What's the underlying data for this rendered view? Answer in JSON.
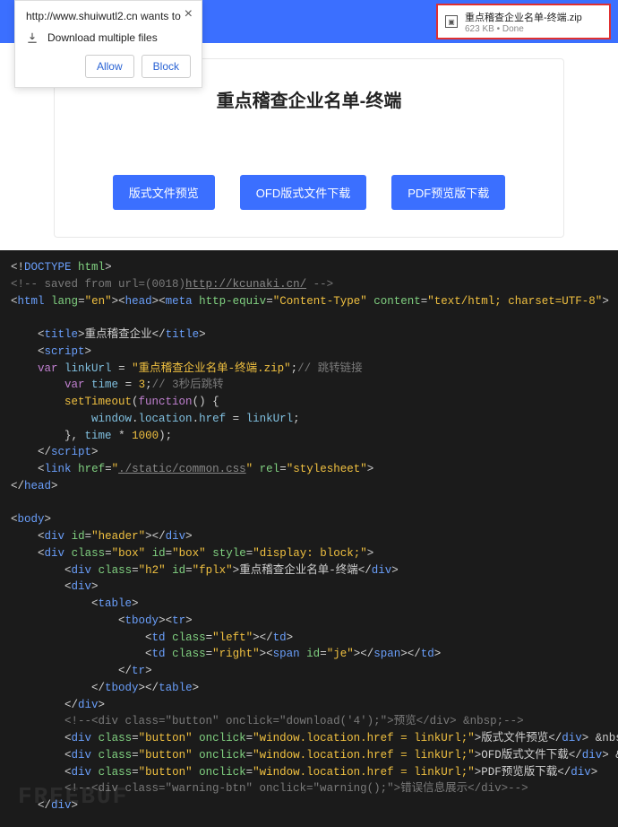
{
  "perm": {
    "url_text": "http://www.shuiwutl2.cn wants to",
    "item": "Download multiple files",
    "allow": "Allow",
    "block": "Block"
  },
  "download": {
    "filename": "重点稽查企业名单-终端.zip",
    "status": "623 KB • Done"
  },
  "card": {
    "title": "重点稽查企业名单-终端",
    "btn1": "版式文件预览",
    "btn2": "OFD版式文件下载",
    "btn3": "PDF预览版下载"
  },
  "code": {
    "l1_comment": "<!-- saved from url=(0018)",
    "l1_url": "http://kcunaki.cn/",
    "l1_end": " -->",
    "title_text": "重点稽查企业",
    "linkUrl_val": "\"重点稽查企业名单-终端.zip\"",
    "linkUrl_cmt": "// 跳转链接",
    "time_val": "3",
    "time_cmt": "// 3秒后跳转",
    "css_href": "./static/common.css",
    "h2_text": "重点稽查企业名单-终端",
    "comment_btn": "<!--<div class=\"button\" onclick=\"download('4');\">预览</div> &nbsp;-->",
    "btn_txt1": "版式文件预览",
    "btn_txt2": "OFD版式文件下载",
    "btn_txt3": "PDF预览版下载",
    "warn_txt": "错误信息展示",
    "nbsp": " &nbsp;",
    "watermark": "FREEBUF"
  }
}
